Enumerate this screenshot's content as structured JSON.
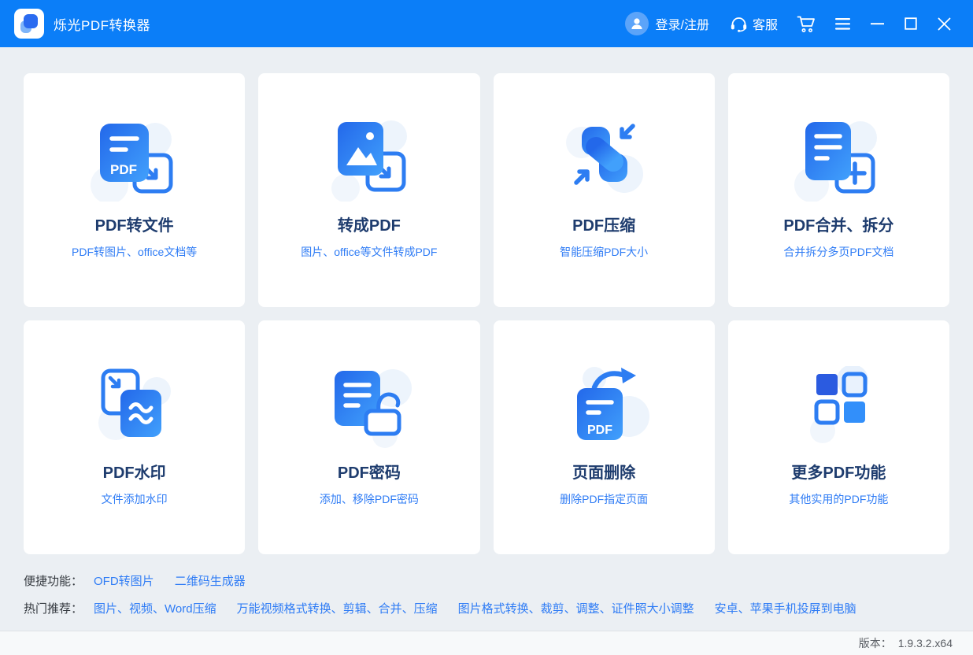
{
  "app": {
    "title": "烁光PDF转换器",
    "logo_icon": "app-logo-p-icon"
  },
  "header": {
    "login": "登录/注册",
    "service": "客服",
    "icons": [
      "avatar-user-icon",
      "headset-icon",
      "cart-icon",
      "menu-icon",
      "minimize-icon",
      "maximize-icon",
      "close-icon"
    ]
  },
  "cards": [
    {
      "title": "PDF转文件",
      "subtitle": "PDF转图片、office文档等",
      "icon": "pdf-to-file-icon"
    },
    {
      "title": "转成PDF",
      "subtitle": "图片、office等文件转成PDF",
      "icon": "to-pdf-icon"
    },
    {
      "title": "PDF压缩",
      "subtitle": "智能压缩PDF大小",
      "icon": "pdf-compress-icon"
    },
    {
      "title": "PDF合并、拆分",
      "subtitle": "合并拆分多页PDF文档",
      "icon": "pdf-merge-split-icon"
    },
    {
      "title": "PDF水印",
      "subtitle": "文件添加水印",
      "icon": "pdf-watermark-icon"
    },
    {
      "title": "PDF密码",
      "subtitle": "添加、移除PDF密码",
      "icon": "pdf-password-icon"
    },
    {
      "title": "页面删除",
      "subtitle": "删除PDF指定页面",
      "icon": "page-delete-icon"
    },
    {
      "title": "更多PDF功能",
      "subtitle": "其他实用的PDF功能",
      "icon": "more-functions-icon"
    }
  ],
  "quick_features": {
    "label": "便捷功能：",
    "links": [
      "OFD转图片",
      "二维码生成器"
    ]
  },
  "hot_recommendations": {
    "label": "热门推荐：",
    "links": [
      "图片、视频、Word压缩",
      "万能视频格式转换、剪辑、合并、压缩",
      "图片格式转换、裁剪、调整、证件照大小调整",
      "安卓、苹果手机投屏到电脑"
    ]
  },
  "footer": {
    "version_label": "版本：",
    "version": "1.9.3.2.x64"
  },
  "colors": {
    "header_bg": "#0b7ef8",
    "accent_blue": "#2f7cf5",
    "card_title": "#1e3c6e",
    "page_bg": "#ebeff3",
    "icon_gradient_start": "#2368ea",
    "icon_gradient_end": "#41a0fc"
  }
}
